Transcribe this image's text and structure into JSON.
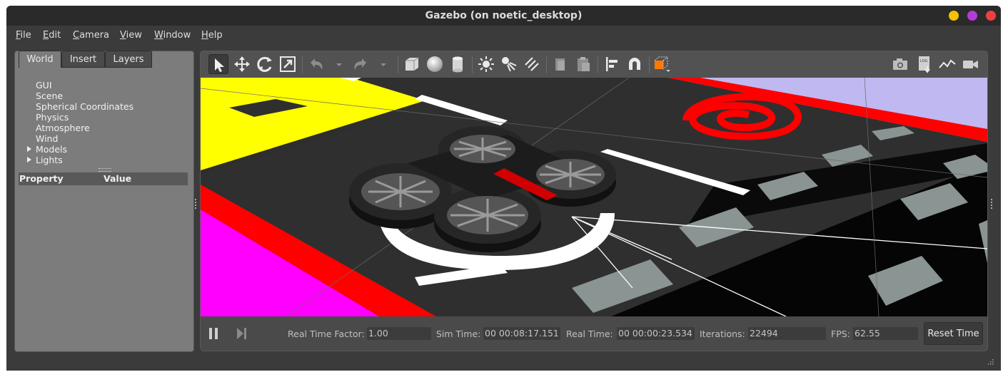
{
  "window": {
    "title": "Gazebo (on noetic_desktop)"
  },
  "menu": [
    {
      "label": "File",
      "mnemonic": "F",
      "rest": "ile"
    },
    {
      "label": "Edit",
      "mnemonic": "E",
      "rest": "dit"
    },
    {
      "label": "Camera",
      "mnemonic": "C",
      "rest": "amera"
    },
    {
      "label": "View",
      "mnemonic": "V",
      "rest": "iew"
    },
    {
      "label": "Window",
      "mnemonic": "W",
      "rest": "indow"
    },
    {
      "label": "Help",
      "mnemonic": "H",
      "rest": "elp"
    }
  ],
  "left_panel": {
    "tabs": [
      "World",
      "Insert",
      "Layers"
    ],
    "active_tab": "World",
    "tree": [
      "GUI",
      "Scene",
      "Spherical Coordinates",
      "Physics",
      "Atmosphere",
      "Wind",
      "Models",
      "Lights"
    ],
    "property_header": {
      "property": "Property",
      "value": "Value"
    }
  },
  "toolbar": {
    "icons": [
      "select-arrow-icon",
      "translate-icon",
      "rotate-icon",
      "scale-icon",
      "undo-icon",
      "redo-icon",
      "box-icon",
      "sphere-icon",
      "cylinder-icon",
      "point-light-icon",
      "spot-light-icon",
      "directional-light-icon",
      "copy-icon",
      "paste-icon",
      "align-icon",
      "snap-magnet-icon",
      "view-angle-icon",
      "screenshot-icon",
      "log-icon",
      "plot-icon",
      "record-video-icon"
    ]
  },
  "bottom_bar": {
    "real_time_factor_label": "Real Time Factor:",
    "real_time_factor": "1.00",
    "sim_time_label": "Sim Time:",
    "sim_time": "00 00:08:17.151",
    "real_time_label": "Real Time:",
    "real_time": "00 00:00:23.534",
    "iterations_label": "Iterations:",
    "iterations": "22494",
    "fps_label": "FPS:",
    "fps": "62.55",
    "reset_label": "Reset Time"
  },
  "colors": {
    "close": "#ee4040",
    "maximize": "#b43cd6",
    "minimize": "#f5c000",
    "floor": "#2f2f2f",
    "yellow": "#ffff00",
    "red": "#ff0000",
    "magenta": "#ff00ff",
    "lavender": "#c0b8f0",
    "grey_tile": "#8a9593"
  }
}
